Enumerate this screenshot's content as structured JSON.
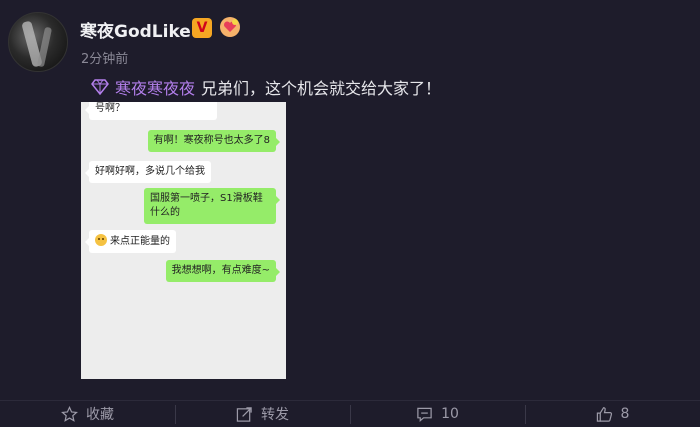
{
  "post": {
    "username": "寒夜GodLike",
    "vip_badge": "V",
    "timestamp": "2分钟前",
    "mention": "寒夜寒夜夜",
    "text": "兄弟们，这个机会就交给大家了！"
  },
  "chat": {
    "messages": [
      {
        "side": "left",
        "text": "号啊？"
      },
      {
        "side": "right",
        "text": "有啊！寒夜称号也太多了8"
      },
      {
        "side": "left",
        "text": "好啊好啊，多说几个给我"
      },
      {
        "side": "right",
        "text": "国服第一喷子，S1滑板鞋什么的"
      },
      {
        "side": "left",
        "text": "来点正能量的"
      },
      {
        "side": "right",
        "text": "我想想啊，有点难度~"
      }
    ]
  },
  "actions": {
    "favorite_label": "收藏",
    "repost_label": "转发",
    "comment_count": "10",
    "like_count": "8"
  },
  "colors": {
    "background": "#1e1c2b",
    "mention": "#b37feb",
    "chat_green": "#95ec69",
    "vip": "#f5a623"
  }
}
